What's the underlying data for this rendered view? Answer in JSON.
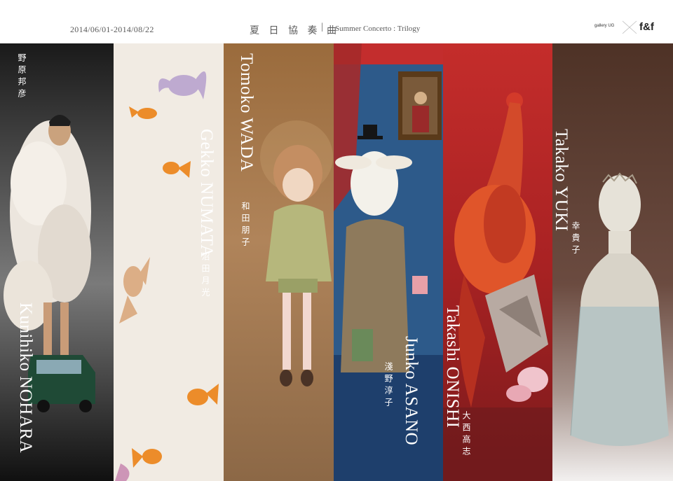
{
  "header": {
    "dates": "2014/06/01-2014/08/22",
    "title_jp": "夏 日 協 奏 曲",
    "separator": "|",
    "title_en": "Summer Concerto : Trilogy",
    "logo_gallery": "gallery UG",
    "logo_fnf": "f&f"
  },
  "artists": [
    {
      "name_en": "Kunihiko NOHARA",
      "name_jp": "野原邦彦",
      "name_color": "#ffffff",
      "background": "#2a2a2a"
    },
    {
      "name_en": "Gekko NUMATA",
      "name_jp": "沼田月光",
      "name_color": "#ffffff",
      "background": "#f1ebe3"
    },
    {
      "name_en": "Tomoko WADA",
      "name_jp": "和田朋子",
      "name_color": "#ffffff",
      "background": "#a8784a"
    },
    {
      "name_en": "Junko ASANO",
      "name_jp": "淺野淳子",
      "name_color": "#ffffff",
      "background": "#2d5a8a"
    },
    {
      "name_en": "Takashi ONISHI",
      "name_jp": "大西高志",
      "name_color": "#ffffff",
      "background": "#b8282a"
    },
    {
      "name_en": "Takako YUKI",
      "name_jp": "幸貴子",
      "name_color": "#ffffff",
      "background": "#5b3d32"
    }
  ]
}
